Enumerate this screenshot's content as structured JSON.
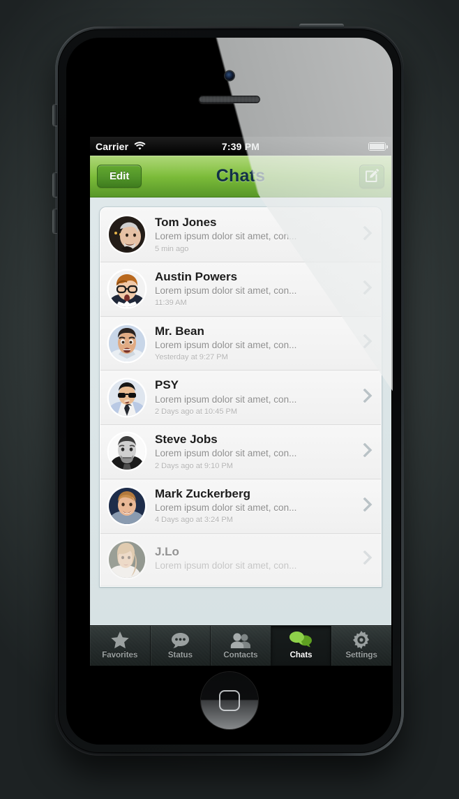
{
  "status_bar": {
    "carrier": "Carrier",
    "wifi_icon": "wifi-icon",
    "time": "7:39 PM",
    "battery_icon": "battery-full-icon"
  },
  "nav_bar": {
    "edit_label": "Edit",
    "title": "Chats",
    "compose_icon": "compose-icon",
    "accent_color": "#7dbd3a",
    "title_color": "#123047"
  },
  "chats": [
    {
      "name": "Tom Jones",
      "preview": "Lorem ipsum dolor sit amet, con...",
      "time": "5 min ago",
      "avatar": "avatar-tom-jones",
      "chevron": "chevron-right-icon"
    },
    {
      "name": "Austin Powers",
      "preview": "Lorem ipsum dolor sit amet, con...",
      "time": "11:39 AM",
      "avatar": "avatar-austin-powers",
      "chevron": "chevron-right-icon"
    },
    {
      "name": "Mr. Bean",
      "preview": "Lorem ipsum dolor sit amet, con...",
      "time": "Yesterday at 9:27 PM",
      "avatar": "avatar-mr-bean",
      "chevron": "chevron-right-icon"
    },
    {
      "name": "PSY",
      "preview": "Lorem ipsum dolor sit amet, con...",
      "time": "2 Days ago at 10:45 PM",
      "avatar": "avatar-psy",
      "chevron": "chevron-right-icon"
    },
    {
      "name": "Steve Jobs",
      "preview": "Lorem ipsum dolor sit amet, con...",
      "time": "2 Days ago at 9:10 PM",
      "avatar": "avatar-steve-jobs",
      "chevron": "chevron-right-icon"
    },
    {
      "name": "Mark Zuckerberg",
      "preview": "Lorem ipsum dolor sit amet, con...",
      "time": "4 Days ago at 3:24 PM",
      "avatar": "avatar-mark-zuckerberg",
      "chevron": "chevron-right-icon"
    },
    {
      "name": "J.Lo",
      "preview": "Lorem ipsum dolor sit amet, con...",
      "time": "",
      "avatar": "avatar-jlo",
      "chevron": "chevron-right-icon"
    }
  ],
  "tab_bar": {
    "active_index": 3,
    "active_color": "#8ed14a",
    "tabs": [
      {
        "label": "Favorites",
        "icon": "star-icon"
      },
      {
        "label": "Status",
        "icon": "speech-bubble-dots-icon"
      },
      {
        "label": "Contacts",
        "icon": "people-icon"
      },
      {
        "label": "Chats",
        "icon": "chat-bubbles-icon"
      },
      {
        "label": "Settings",
        "icon": "gear-icon"
      }
    ]
  },
  "device": {
    "camera_icon": "front-camera",
    "speaker_icon": "earpiece-speaker",
    "home_button_icon": "home-button",
    "mute_switch": "mute-switch",
    "volume_up": "volume-up-button",
    "volume_down": "volume-down-button",
    "power_button": "power-button"
  }
}
